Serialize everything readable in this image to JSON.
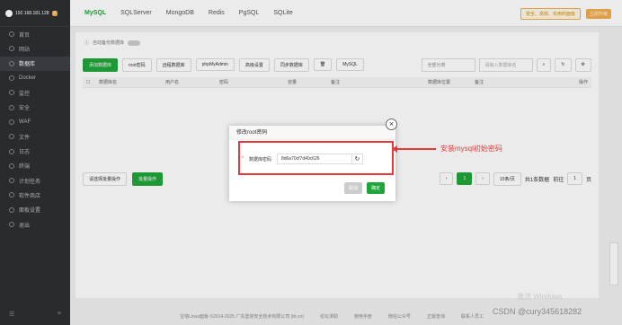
{
  "sidebar": {
    "ip": "192.168.181.128",
    "badge": "0",
    "items": [
      {
        "label": "首页"
      },
      {
        "label": "网站"
      },
      {
        "label": "数据库"
      },
      {
        "label": "Docker"
      },
      {
        "label": "监控"
      },
      {
        "label": "安全"
      },
      {
        "label": "WAF"
      },
      {
        "label": "文件"
      },
      {
        "label": "日志"
      },
      {
        "label": "终端"
      },
      {
        "label": "计划任务"
      },
      {
        "label": "软件商店"
      },
      {
        "label": "面板设置"
      },
      {
        "label": "退出"
      }
    ]
  },
  "tabs": [
    "MySQL",
    "SQLServer",
    "MongoDB",
    "Redis",
    "PgSQL",
    "SQLite"
  ],
  "topbar": {
    "notice": "安全、高效、实用的面板",
    "upgrade": "立即升级"
  },
  "info": "自动备份数据库",
  "toolbar": {
    "add": "添加数据库",
    "root": "root密码",
    "remote": "远程数据库",
    "pma": "phpMyAdmin",
    "advanced": "高级设置",
    "sync": "同步数据库",
    "mysql": "MySQL",
    "category": "全部分类",
    "search_placeholder": "请输入数据库名"
  },
  "table_headers": [
    "数据库名",
    "用户名",
    "密码",
    "容量",
    "备注",
    "数据库位置",
    "备注",
    "操作"
  ],
  "table_footer": {
    "batch": "请选择批量操作",
    "exec": "批量操作",
    "page": "1",
    "per_page": "10条/页",
    "total": "共1条数据",
    "goto": "前往",
    "page_input": "1",
    "page_suffix": "页"
  },
  "footer": [
    "宝塔Linux面板 ©2014-2025 广东堡塔安全技术有限公司 (bt.cn)",
    "论坛求助",
    "使用手册",
    "微信公众号",
    "正版查询",
    "联系人员工"
  ],
  "modal": {
    "title": "修改root密码",
    "label": "数据库密码",
    "password": "8d6a70cf7d40c626",
    "cancel": "取消",
    "ok": "确定",
    "close": "×"
  },
  "annotation": "安装mysql初始密码",
  "watermark": "激活 Windows",
  "csdn": "CSDN @cury345618282"
}
